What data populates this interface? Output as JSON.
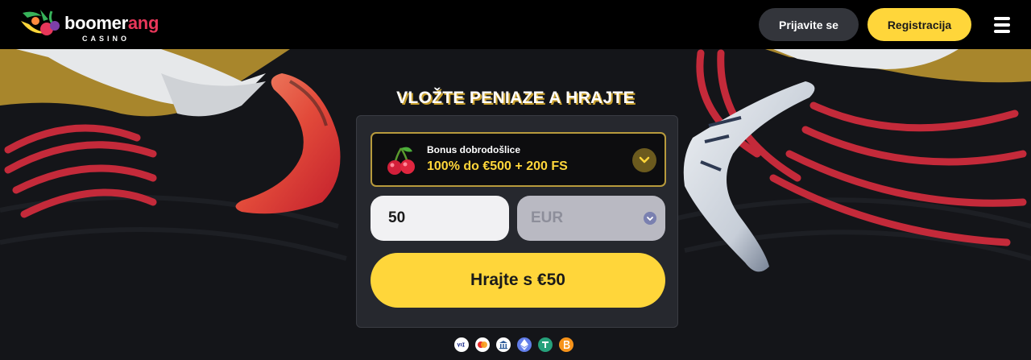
{
  "header": {
    "logo": {
      "word_primary": "boomer",
      "word_accent": "ang",
      "subtitle": "CASINO"
    },
    "login_label": "Prijavite se",
    "register_label": "Registracija",
    "menu_icon": "hamburger-icon"
  },
  "hero": {
    "title": "VLOŽTE PENIAZE A HRAJTE",
    "bonus": {
      "icon": "cherry-icon",
      "label": "Bonus dobrodošlice",
      "value": "100% do €500 + 200 FS"
    },
    "amount_value": "50",
    "currency_value": "EUR",
    "play_label": "Hrajte s €50"
  },
  "payments": [
    "visa-icon",
    "mastercard-icon",
    "bank-icon",
    "ethereum-icon",
    "tether-icon",
    "bitcoin-icon"
  ],
  "colors": {
    "accent_yellow": "#ffd63a",
    "brand_red": "#e8375a",
    "header_bg": "#000000",
    "page_bg": "#141519",
    "panel_bg": "#26282e"
  }
}
